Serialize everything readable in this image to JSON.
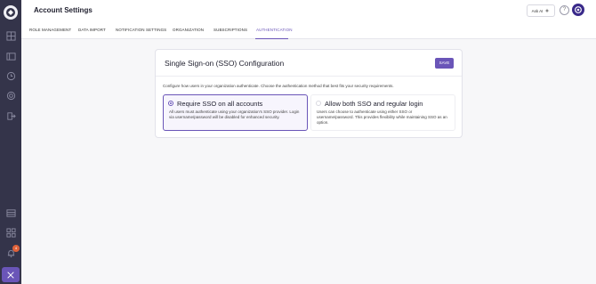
{
  "header": {
    "title": "Account Settings",
    "ask_ai_label": "Ask AI",
    "help_symbol": "?"
  },
  "sidebar": {
    "items": [
      {
        "icon": "dashboard-icon"
      },
      {
        "icon": "layers-icon"
      },
      {
        "icon": "clock-icon"
      },
      {
        "icon": "target-icon"
      },
      {
        "icon": "export-icon"
      },
      {
        "icon": "table-icon"
      },
      {
        "icon": "grid-icon"
      },
      {
        "icon": "bell-icon"
      }
    ],
    "notification_count": "4"
  },
  "tabs": [
    {
      "label": "ROLE MANAGEMENT",
      "active": false
    },
    {
      "label": "DATA IMPORT",
      "active": false
    },
    {
      "label": "NOTIFICATION SETTINGS",
      "active": false
    },
    {
      "label": "ORGANIZATION",
      "active": false
    },
    {
      "label": "SUBSCRIPTIONS",
      "active": false
    },
    {
      "label": "AUTHENTICATION",
      "active": true
    }
  ],
  "sso": {
    "title": "Single Sign-on (SSO) Configuration",
    "save_label": "SAVE",
    "description": "Configure how users in your organization authenticate. Choose the authentication method that best fits your security requirements.",
    "options": [
      {
        "title": "Require SSO on all accounts",
        "description": "All users must authenticate using your organization's SSO provider. Login via username/password will be disabled for enhanced security.",
        "selected": true
      },
      {
        "title": "Allow both SSO and regular login",
        "description": "Users can choose to authenticate using either SSO or username/password. This provides flexibility while maintaining SSO as an option.",
        "selected": false
      }
    ]
  },
  "colors": {
    "accent": "#6a55b8",
    "sidebar": "#34344a",
    "badge": "#e0623a"
  }
}
